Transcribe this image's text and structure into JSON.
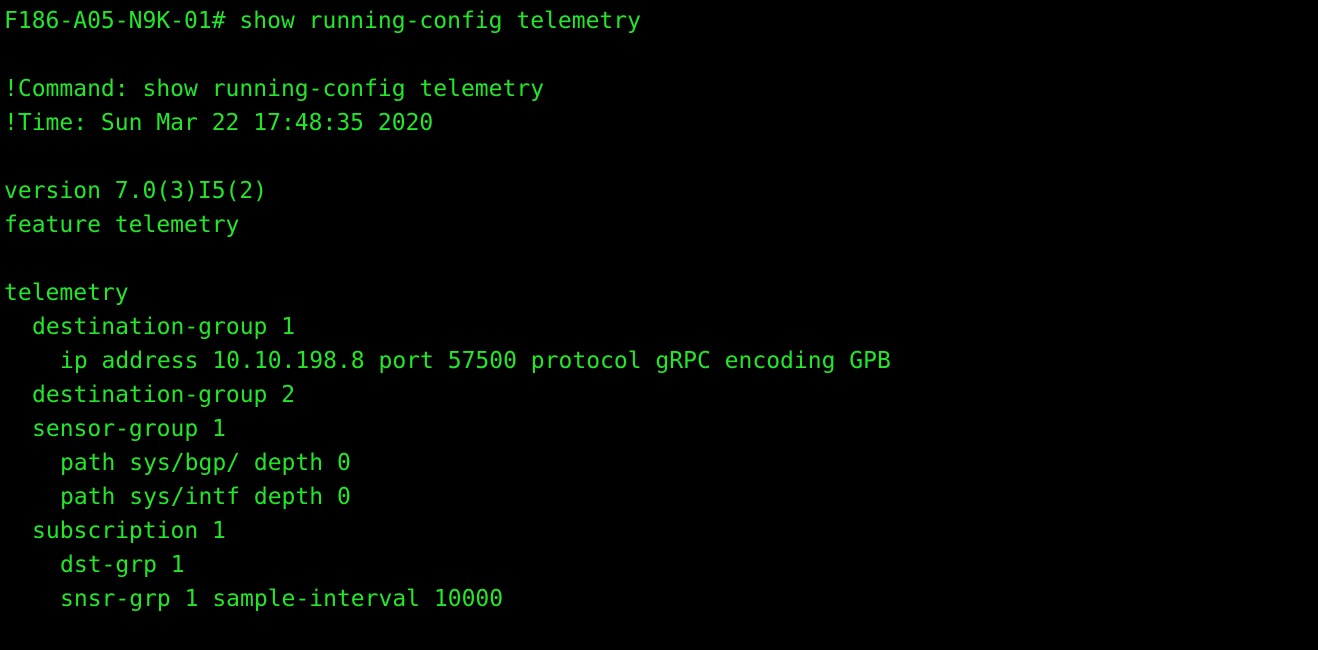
{
  "terminal": {
    "text_color": "#23e62a",
    "background_color": "#000000",
    "prompt": "F186-A05-N9K-01#",
    "command": " show running-config telemetry",
    "output": {
      "comment_command": "!Command: show running-config telemetry",
      "comment_time": "!Time: Sun Mar 22 17:48:35 2020",
      "version": "version 7.0(3)I5(2)",
      "feature": "feature telemetry",
      "telemetry": "telemetry",
      "dest_group_1": "destination-group 1",
      "dest_group_1_ip": "ip address 10.10.198.8 port 57500 protocol gRPC encoding GPB",
      "dest_group_2": "destination-group 2",
      "sensor_group_1": "sensor-group 1",
      "path_bgp": "path sys/bgp/ depth 0",
      "path_intf": "path sys/intf depth 0",
      "subscription_1": "subscription 1",
      "dst_grp": "dst-grp 1",
      "snsr_grp": "snsr-grp 1 sample-interval 10000"
    }
  }
}
